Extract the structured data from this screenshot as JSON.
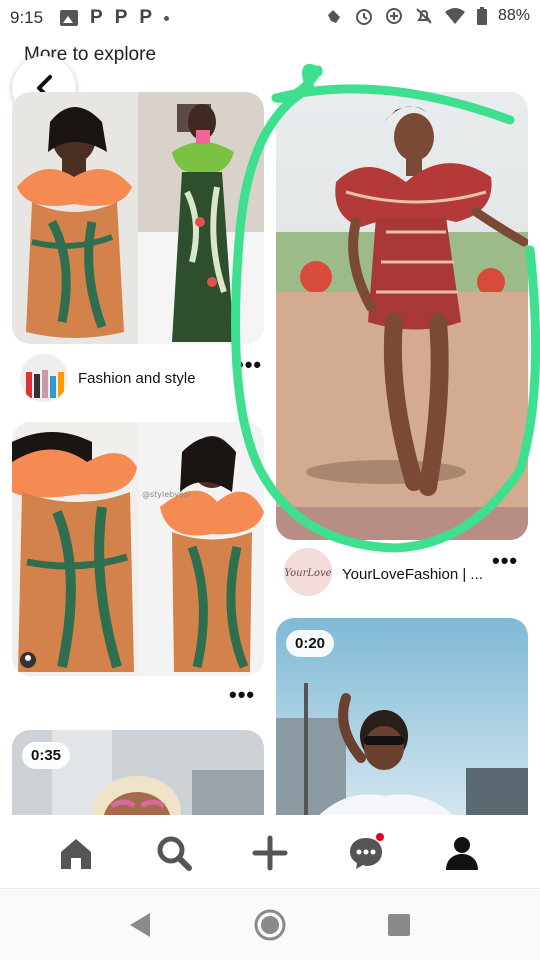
{
  "status_bar": {
    "time": "9:15",
    "p_icons": [
      "P",
      "P",
      "P"
    ],
    "battery_percent": "88%"
  },
  "header": {
    "title": "More to explore"
  },
  "pins": [
    {
      "id": "fashion-collage-1",
      "user": "Fashion and style",
      "video_length": null
    },
    {
      "id": "red-dress",
      "user": "YourLoveFashion | ...",
      "video_length": null
    },
    {
      "id": "fashion-collage-2",
      "user": null,
      "watermark": "@stylebysoi",
      "video_length": null
    },
    {
      "id": "bottom-left-video",
      "user": null,
      "video_length": "0:35"
    },
    {
      "id": "bottom-right-video",
      "user": null,
      "video_length": "0:20"
    }
  ],
  "avatar_script_text": "YourLove",
  "more_menu": "•••",
  "bottom_nav": {
    "items": [
      "home-icon",
      "search-icon",
      "create-icon",
      "messages-icon",
      "profile-icon"
    ],
    "messages_has_notification": true
  },
  "system_nav": [
    "back",
    "home",
    "recents"
  ],
  "colors": {
    "annotation": "#3ee08f",
    "notification": "#e60023",
    "orange_ruffle": "#f58a52",
    "red_dress": "#b43a3a"
  }
}
